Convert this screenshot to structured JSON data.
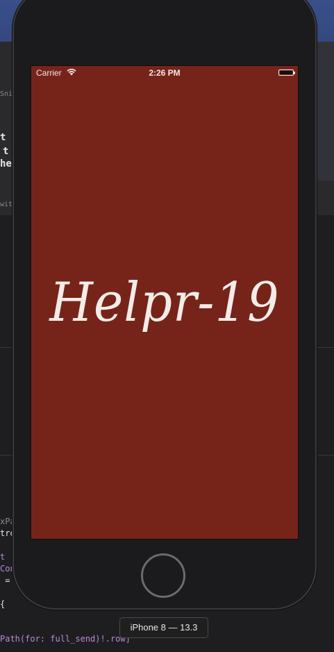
{
  "status_bar": {
    "carrier": "Carrier",
    "time": "2:26 PM"
  },
  "app": {
    "title": "Helpr-19"
  },
  "device": {
    "label": "iPhone 8 — 13.3"
  },
  "background_snippets": {
    "left_1": "Snip",
    "left_2": "t",
    "left_3": "t",
    "left_4": "he",
    "left_5": "with",
    "code_1": "xPa",
    "code_2": "tro",
    "code_3": "t",
    "code_4": "Con",
    "code_5": " =",
    "code_6": "{",
    "code_last": "Path(for: full_send)!.row]"
  }
}
